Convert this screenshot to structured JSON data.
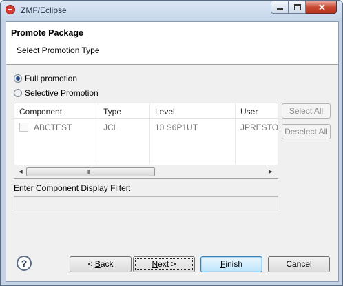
{
  "window": {
    "title": "ZMF/Eclipse",
    "close_glyph": "✕"
  },
  "header": {
    "title": "Promote Package",
    "subtitle": "Select Promotion Type"
  },
  "promotion_options": [
    {
      "label": "Full promotion",
      "checked": true
    },
    {
      "label": "Selective Promotion",
      "checked": false
    }
  ],
  "table": {
    "columns": [
      "Component",
      "Type",
      "Level",
      "User"
    ],
    "rows": [
      {
        "component": "ABCTEST",
        "type": "JCL",
        "level": "10 S6P1UT",
        "user": "JPRESTO",
        "checked": false
      }
    ],
    "scroll_left": "◀",
    "scroll_right": "▶",
    "grip": "III"
  },
  "side_buttons": {
    "select_all": "Select All",
    "deselect_all": "Deselect All"
  },
  "filter": {
    "label": "Enter Component Display Filter:",
    "value": ""
  },
  "footer": {
    "help": "?",
    "back": {
      "prefix": "< ",
      "mnemonic": "B",
      "rest": "ack"
    },
    "next": {
      "mnemonic": "N",
      "rest": "ext >"
    },
    "finish": {
      "mnemonic": "F",
      "rest": "inish"
    },
    "cancel": "Cancel"
  }
}
